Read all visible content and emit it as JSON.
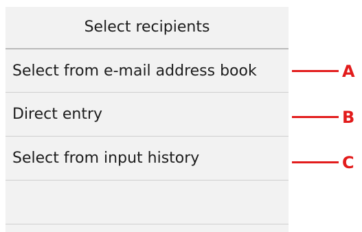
{
  "screen": {
    "title": "Select recipients"
  },
  "menu": {
    "items": [
      {
        "label": "Select from e-mail address book",
        "callout": "A"
      },
      {
        "label": "Direct entry",
        "callout": "B"
      },
      {
        "label": "Select from input history",
        "callout": "C"
      },
      {
        "label": "",
        "callout": ""
      }
    ]
  },
  "colors": {
    "panel_background": "#f2f2f2",
    "callout": "#e21b1b",
    "divider": "#cfcfcf"
  }
}
